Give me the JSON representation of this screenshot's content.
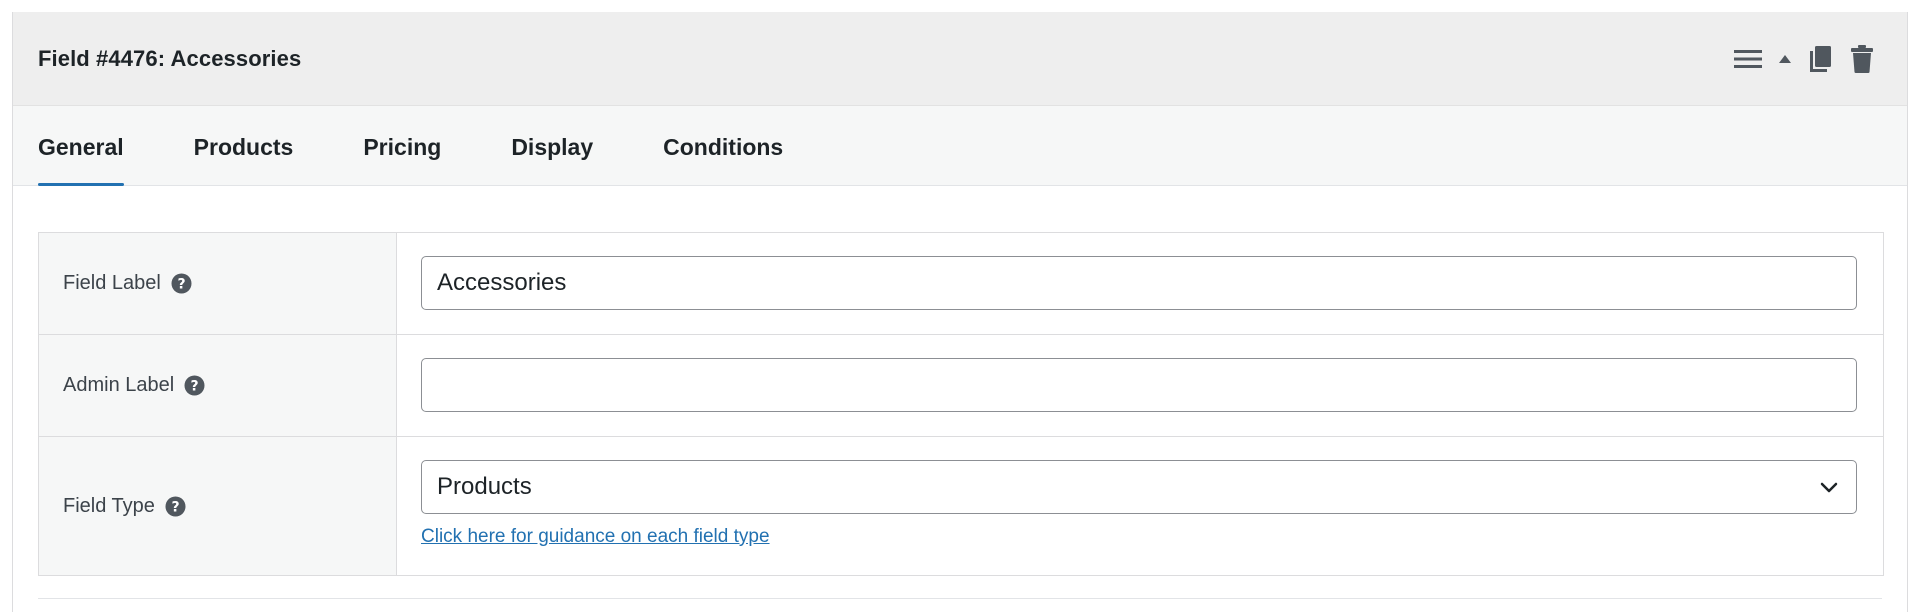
{
  "header": {
    "title": "Field #4476: Accessories",
    "actions": [
      {
        "name": "menu",
        "icon": "hamburger-menu-icon"
      },
      {
        "name": "collapse",
        "icon": "caret-up-icon"
      },
      {
        "name": "duplicate",
        "icon": "copy-icon"
      },
      {
        "name": "delete",
        "icon": "trash-icon"
      }
    ]
  },
  "tabs": [
    {
      "label": "General",
      "active": true
    },
    {
      "label": "Products",
      "active": false
    },
    {
      "label": "Pricing",
      "active": false
    },
    {
      "label": "Display",
      "active": false
    },
    {
      "label": "Conditions",
      "active": false
    }
  ],
  "form": {
    "field_label": {
      "label": "Field Label",
      "value": "Accessories",
      "help_icon": "question-circle-icon"
    },
    "admin_label": {
      "label": "Admin Label",
      "value": "",
      "help_icon": "question-circle-icon"
    },
    "field_type": {
      "label": "Field Type",
      "selected": "Products",
      "help_icon": "question-circle-icon",
      "guidance_link": "Click here for guidance on each field type"
    }
  },
  "colors": {
    "accent": "#2271b1",
    "header_bg": "#eeeeee",
    "tabs_bg": "#f6f7f7",
    "label_bg": "#f6f7f7",
    "border": "#dcdcde",
    "icon": "#50575e"
  }
}
